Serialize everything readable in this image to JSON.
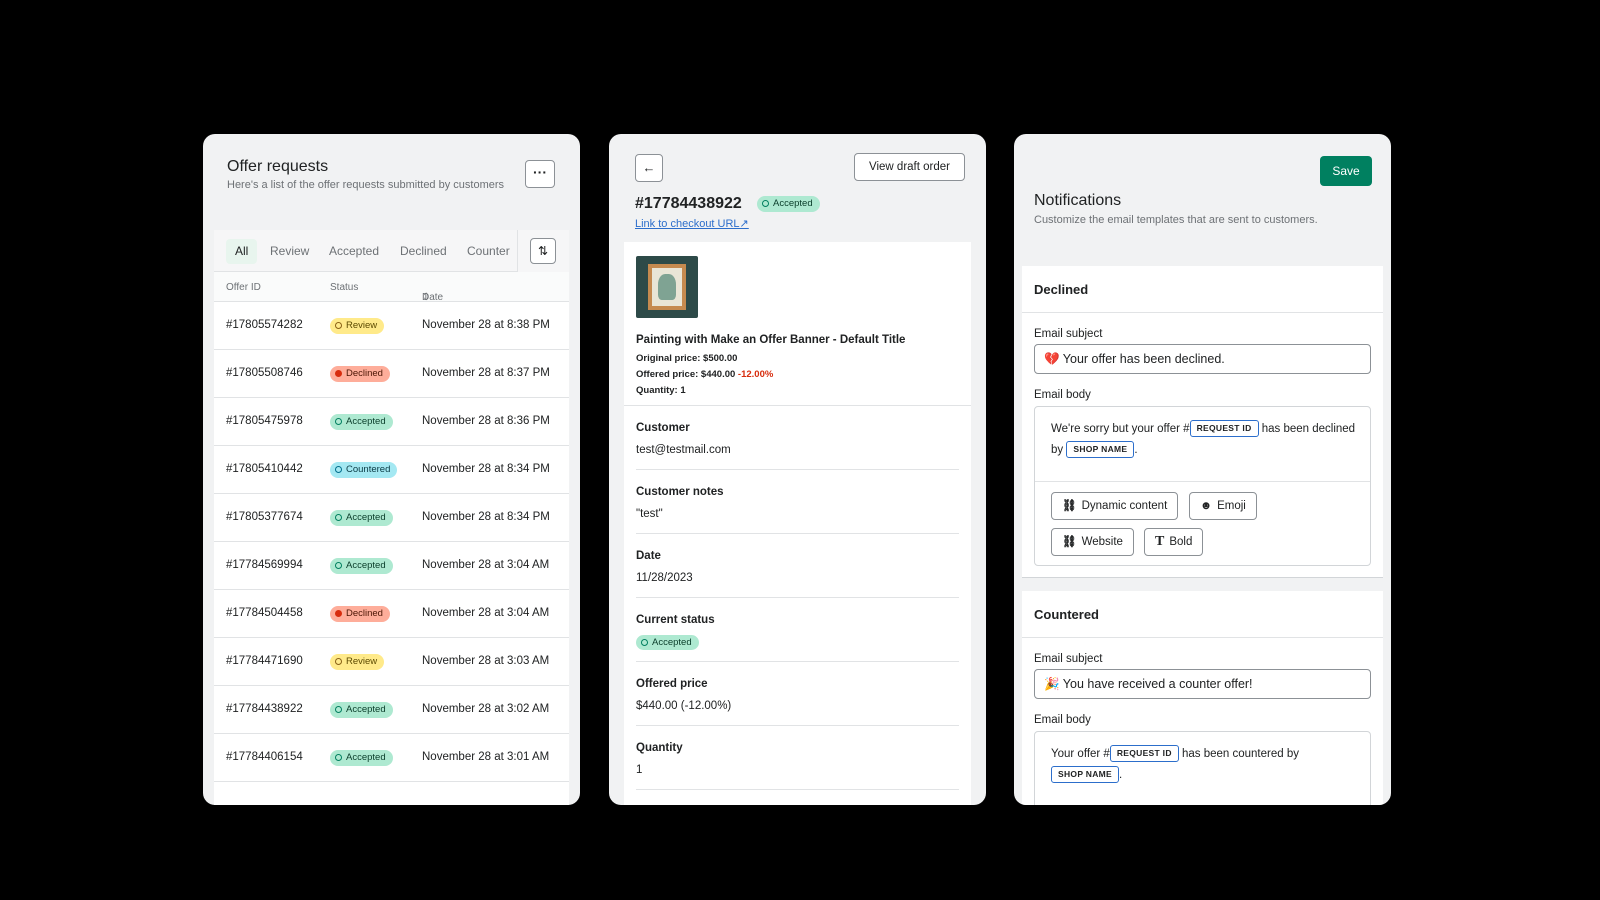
{
  "offers": {
    "title": "Offer requests",
    "subtitle": "Here's a list of the offer requests submitted by customers",
    "more_label": "···",
    "tabs": [
      "All",
      "Review",
      "Accepted",
      "Declined",
      "Counter"
    ],
    "sort_icon": "sort-icon",
    "columns": {
      "id": "Offer ID",
      "status": "Status",
      "date": "Date"
    },
    "rows": [
      {
        "id": "#17805574282",
        "status": "Review",
        "date": "November 28 at 8:38 PM"
      },
      {
        "id": "#17805508746",
        "status": "Declined",
        "date": "November 28 at 8:37 PM"
      },
      {
        "id": "#17805475978",
        "status": "Accepted",
        "date": "November 28 at 8:36 PM"
      },
      {
        "id": "#17805410442",
        "status": "Countered",
        "date": "November 28 at 8:34 PM"
      },
      {
        "id": "#17805377674",
        "status": "Accepted",
        "date": "November 28 at 8:34 PM"
      },
      {
        "id": "#17784569994",
        "status": "Accepted",
        "date": "November 28 at 3:04 AM"
      },
      {
        "id": "#17784504458",
        "status": "Declined",
        "date": "November 28 at 3:04 AM"
      },
      {
        "id": "#17784471690",
        "status": "Review",
        "date": "November 28 at 3:03 AM"
      },
      {
        "id": "#17784438922",
        "status": "Accepted",
        "date": "November 28 at 3:02 AM"
      },
      {
        "id": "#17784406154",
        "status": "Accepted",
        "date": "November 28 at 3:01 AM"
      }
    ]
  },
  "detail": {
    "back_icon": "arrow-left-icon",
    "view_draft_label": "View draft order",
    "offer_id": "#17784438922",
    "status_badge": "Accepted",
    "checkout_link": "Link to checkout URL↗",
    "product": {
      "name": "Painting with Make an Offer Banner - Default Title",
      "original_price": "Original price: $500.00",
      "offered_price": "Offered price: $440.00",
      "discount": "-12.00%",
      "quantity": "Quantity: 1"
    },
    "sections": [
      {
        "label": "Customer",
        "value": "test@testmail.com"
      },
      {
        "label": "Customer notes",
        "value": "\"test\""
      },
      {
        "label": "Date",
        "value": "11/28/2023"
      },
      {
        "label": "Current status",
        "value": "Accepted"
      },
      {
        "label": "Offered price",
        "value": "$440.00 (-12.00%)"
      },
      {
        "label": "Quantity",
        "value": "1"
      }
    ]
  },
  "notifications": {
    "save_label": "Save",
    "title": "Notifications",
    "subtitle": "Customize the email templates that are sent to customers.",
    "declined": {
      "heading": "Declined",
      "subject_label": "Email subject",
      "subject_value": "💔 Your offer has been declined.",
      "body_label": "Email body",
      "body_part1": "We're sorry but your offer #",
      "token_request": "REQUEST ID",
      "body_part2": " has been declined by ",
      "token_shop": "SHOP NAME",
      "body_part3": ".",
      "tools": [
        "Dynamic content",
        "Emoji",
        "Website",
        "Bold"
      ]
    },
    "countered": {
      "heading": "Countered",
      "subject_label": "Email subject",
      "subject_value": "🎉 You have received a counter offer!",
      "body_label": "Email body",
      "body_part1": "Your offer #",
      "token_request": "REQUEST ID",
      "body_part2": " has been countered by ",
      "token_shop": "SHOP NAME",
      "body_part3": "."
    }
  },
  "colors": {
    "save": "#008060",
    "review": "#ffea8a",
    "declined": "#fead9a",
    "accepted": "#aee9d1",
    "countered": "#a4e8f2",
    "link": "#2c6ecb"
  }
}
